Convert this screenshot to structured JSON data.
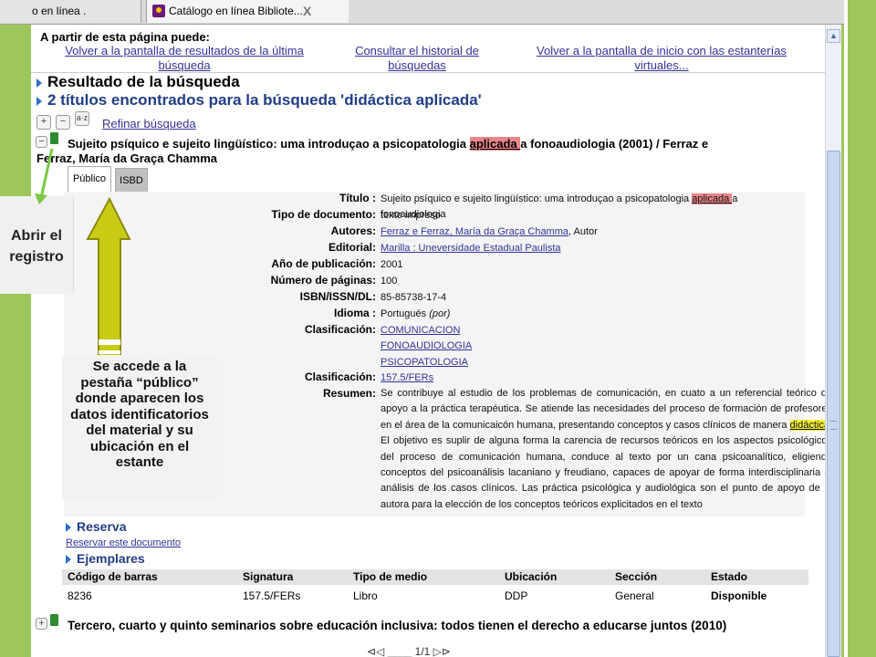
{
  "browser": {
    "tabs": [
      {
        "label": "o en línea ."
      },
      {
        "label": "Catálogo en línea Bibliote..."
      }
    ],
    "close_symbol": "X"
  },
  "nav": {
    "heading": "A partir de esta página puede:",
    "links": [
      {
        "line1": "Volver a la pantalla de resultados de la última",
        "line2": "búsqueda"
      },
      {
        "line1": "Consultar el historial de",
        "line2": "búsquedas"
      },
      {
        "line1": "Volver a la pantalla de inicio con las estanterías",
        "line2": "virtuales..."
      }
    ]
  },
  "results": {
    "heading": "Resultado de la búsqueda",
    "found": "2 títulos encontrados para la búsqueda 'didáctica aplicada'",
    "refine": "Refinar búsqueda",
    "tool_az": "a·z",
    "tool_plus": "+",
    "tool_minus": "−"
  },
  "record1": {
    "expander": "−",
    "title_part1": "Sujeito psíquico e sujeito lingüístico: uma introduçao a psicopatologia ",
    "title_highlight": "aplicada ",
    "title_part2": "a fonoaudiologia (2001) / Ferraz e",
    "title_line2": "Ferraz, María da Graça Chamma",
    "tabs": [
      "Público",
      "ISBD"
    ],
    "fields": {
      "titulo_label": "Título :",
      "titulo_1": "Sujeito psíquico e sujeito lingüístico: uma introduçao a psicopatologia ",
      "titulo_hl": "aplicada ",
      "titulo_2": "a fonoaudiologia",
      "tipo_label": "Tipo de documento:",
      "tipo": "texto impreso",
      "autores_label": "Autores:",
      "autores_link": "Ferraz e Ferraz, María da Graça Chamma",
      "autores_role": ", Autor",
      "editorial_label": "Editorial:",
      "editorial": "Marilla : Uneversidade Estadual Paulista",
      "anio_label": "Año de publicación:",
      "anio": "2001",
      "paginas_label": "Número de páginas:",
      "paginas": "100",
      "isbn_label": "ISBN/ISSN/DL:",
      "isbn": "85-85738-17-4",
      "idioma_label": "Idioma :",
      "idioma": "Portugués",
      "idioma_code": "(por)",
      "clasif_label": "Clasificación:",
      "clasif_1": "COMUNICACION",
      "clasif_2": "FONOAUDIOLOGIA",
      "clasif_3": "PSICOPATOLOGIA",
      "clasif2_label": "Clasificación:",
      "clasif2": "157.5/FERs",
      "resumen_label": "Resumen:",
      "resumen_1": "Se contribuye al estudio de los problemas de comunicación, en cuato a un referencial teórico de apoyo a la práctica terapéutica. Se atiende las necesidades del proceso de formación de profesores en el área de la comunicaicón humana, presentando conceptos y casos clínicos de manera ",
      "resumen_hl": "didáctica",
      "resumen_2": ". El objetivo es suplir de alguna forma la carencia de recursos teóricos en los aspectos psicológicos del proceso de comunicación humana, conduce al texto por un cana psicoanalítico, eligiendo conceptos del psicoanálisis lacaniano y freudiano, capaces de apoyar de forma interdisciplinaria el análisis de los casos clínicos. Las práctica psicológica y audiológica son el punto de apoyo de la autora para la elección de los conceptos teóricos explicitados en el texto"
    },
    "reserva_heading": "Reserva",
    "reserva_link": "Reservar este documento",
    "ejemplares_heading": "Ejemplares",
    "table": {
      "headers": [
        "Código de barras",
        "Signatura",
        "Tipo de medio",
        "Ubicación",
        "Sección",
        "Estado"
      ],
      "row": [
        "8236",
        "157.5/FERs",
        "Libro",
        "DDP",
        "General",
        "Disponible"
      ]
    }
  },
  "record2": {
    "expander": "+",
    "title": "Tercero, cuarto y quinto seminarios sobre educación inclusiva: todos tienen el derecho a educarse juntos (2010)"
  },
  "pager": "⊲◁  ____ 1/1  ▷⊳",
  "annotations": {
    "abrir_line1": "Abrir el",
    "abrir_line2": "registro",
    "callout": "Se accede a la pestaña “público” donde aparecen los datos identificatorios del material y su ubicación en el estante"
  },
  "colors": {
    "slide_green": "#9dc75a",
    "arrow_yellow": "#c8cc14",
    "link_blue": "#333399",
    "heading_blue": "#223d85",
    "highlight_red": "#e8868a",
    "highlight_yellow": "#f4ee36"
  }
}
